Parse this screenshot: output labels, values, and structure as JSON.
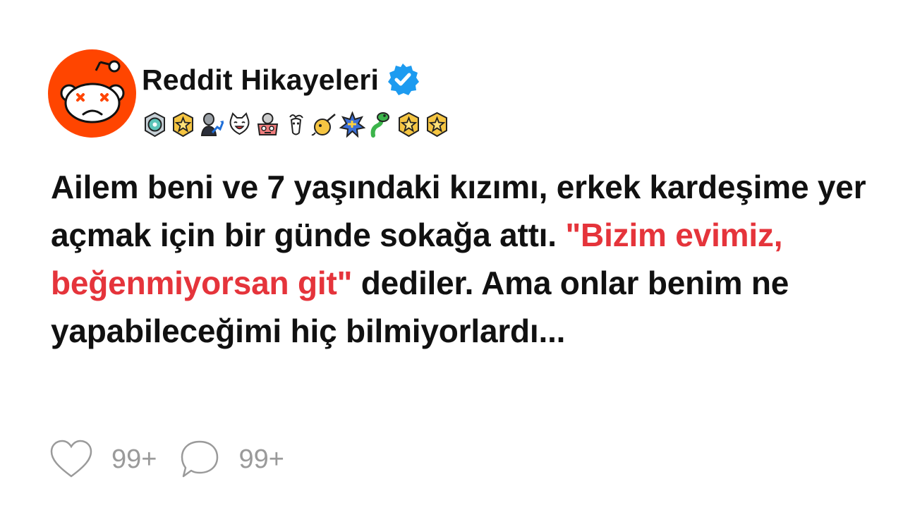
{
  "profile": {
    "name": "Reddit Hikayeleri",
    "verified": true,
    "avatar_color": "#ff4500",
    "avatar_icon": "reddit-snoo-dizzy-icon"
  },
  "badges": [
    {
      "icon": "helper-medal-icon"
    },
    {
      "icon": "gold-star-award-icon"
    },
    {
      "icon": "stonks-award-icon"
    },
    {
      "icon": "cat-laugh-award-icon"
    },
    {
      "icon": "mind-blown-award-icon"
    },
    {
      "icon": "goat-award-icon"
    },
    {
      "icon": "narwhal-award-icon"
    },
    {
      "icon": "plus-one-award-icon"
    },
    {
      "icon": "snake-award-icon"
    },
    {
      "icon": "gold-star-award-icon"
    },
    {
      "icon": "gold-star-award-icon"
    }
  ],
  "post": {
    "text_before": "Ailem beni ve 7 yaşındaki kızımı, erkek kardeşime yer açmak için bir günde sokağa attı. ",
    "quote": "\"Bizim evimiz, beğenmiyorsan git\"",
    "text_after": " dediler. Ama onlar benim ne yapabileceğimi hiç bilmiyorlardı...",
    "quote_color": "#e5343b"
  },
  "actions": {
    "likes": "99+",
    "comments": "99+"
  }
}
